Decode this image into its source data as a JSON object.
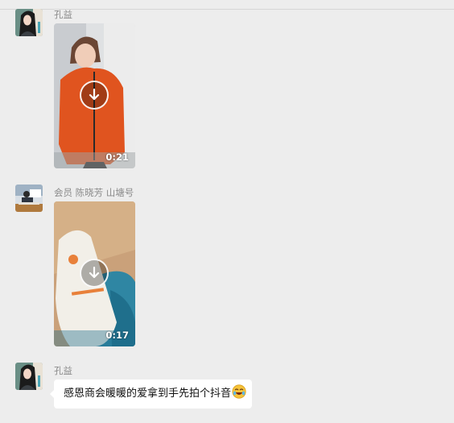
{
  "messages": [
    {
      "sender": "孔益",
      "type": "video",
      "duration": "0:21",
      "avatar": "woman-avatar"
    },
    {
      "sender": "会员 陈晓芳 山塘号",
      "type": "video",
      "duration": "0:17",
      "avatar": "kitchen-avatar"
    },
    {
      "sender": "孔益",
      "type": "text",
      "text": "感恩商会暖暖的爱拿到手先拍个抖音",
      "emoji": "laughing-emoji",
      "avatar": "woman-avatar"
    }
  ],
  "colors": {
    "background": "#ededed",
    "bubble": "#ffffff",
    "sender_name": "#8a8a8a"
  }
}
